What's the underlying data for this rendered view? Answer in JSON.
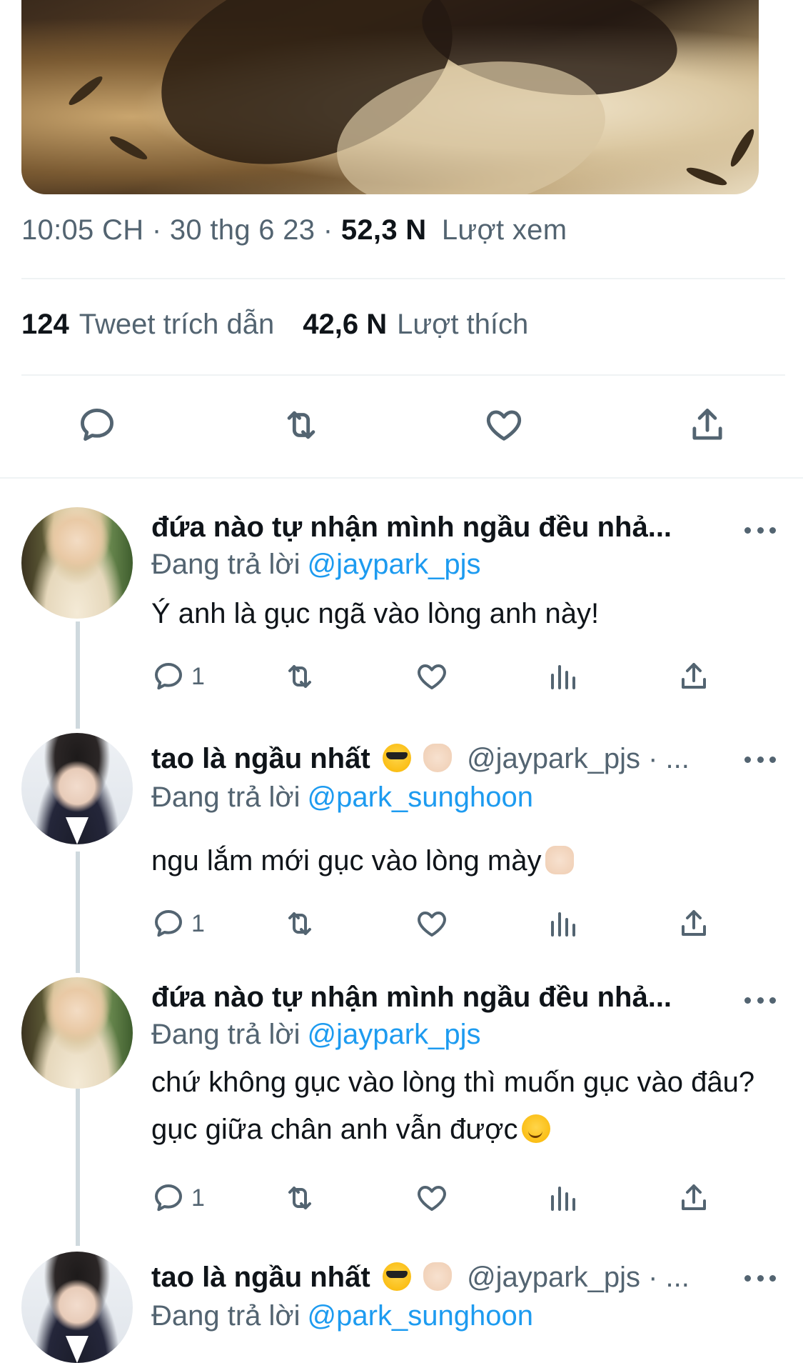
{
  "tweet": {
    "time": "10:05 CH",
    "date": "30 thg 6 23",
    "views_count": "52,3 N",
    "views_label": "Lượt xem",
    "quotes_count": "124",
    "quotes_label": "Tweet trích dẫn",
    "likes_count": "42,6 N",
    "likes_label": "Lượt thích",
    "separator": "·"
  },
  "tweet_actions": {
    "icons": [
      "reply-icon",
      "retweet-icon",
      "like-icon",
      "share-icon"
    ]
  },
  "replies": [
    {
      "name": "đứa nào tự nhận mình ngầu đều nhả...",
      "handle": "",
      "replying_label": "Đang trả lời",
      "mention": "@jaypark_pjs",
      "text": "Ý anh là gục ngã vào lòng anh này!",
      "reply_count": "1",
      "avatar": "blond-avatar"
    },
    {
      "name": "tao là ngầu nhất",
      "handle": "@jaypark_pjs · ...",
      "replying_label": "Đang trả lời",
      "mention": "@park_sunghoon",
      "text": "ngu lắm mới gục vào lòng mày",
      "reply_count": "1",
      "avatar": "dark-hair-avatar"
    },
    {
      "name": "đứa nào tự nhận mình ngầu đều nhả...",
      "handle": "",
      "replying_label": "Đang trả lời",
      "mention": "@jaypark_pjs",
      "text": "chứ không gục vào lòng thì muốn gục vào đâu? gục giữa chân anh vẫn được",
      "reply_count": "1",
      "avatar": "blond-avatar"
    },
    {
      "name": "tao là ngầu nhất",
      "handle": "@jaypark_pjs · ...",
      "replying_label": "Đang trả lời",
      "mention": "@park_sunghoon",
      "text": "",
      "reply_count": "",
      "avatar": "dark-hair-avatar"
    }
  ],
  "colors": {
    "text_primary": "#0f1419",
    "text_secondary": "#536471",
    "link": "#1d9bf0",
    "divider": "#eff3f4",
    "thread_line": "#cfd9de"
  }
}
